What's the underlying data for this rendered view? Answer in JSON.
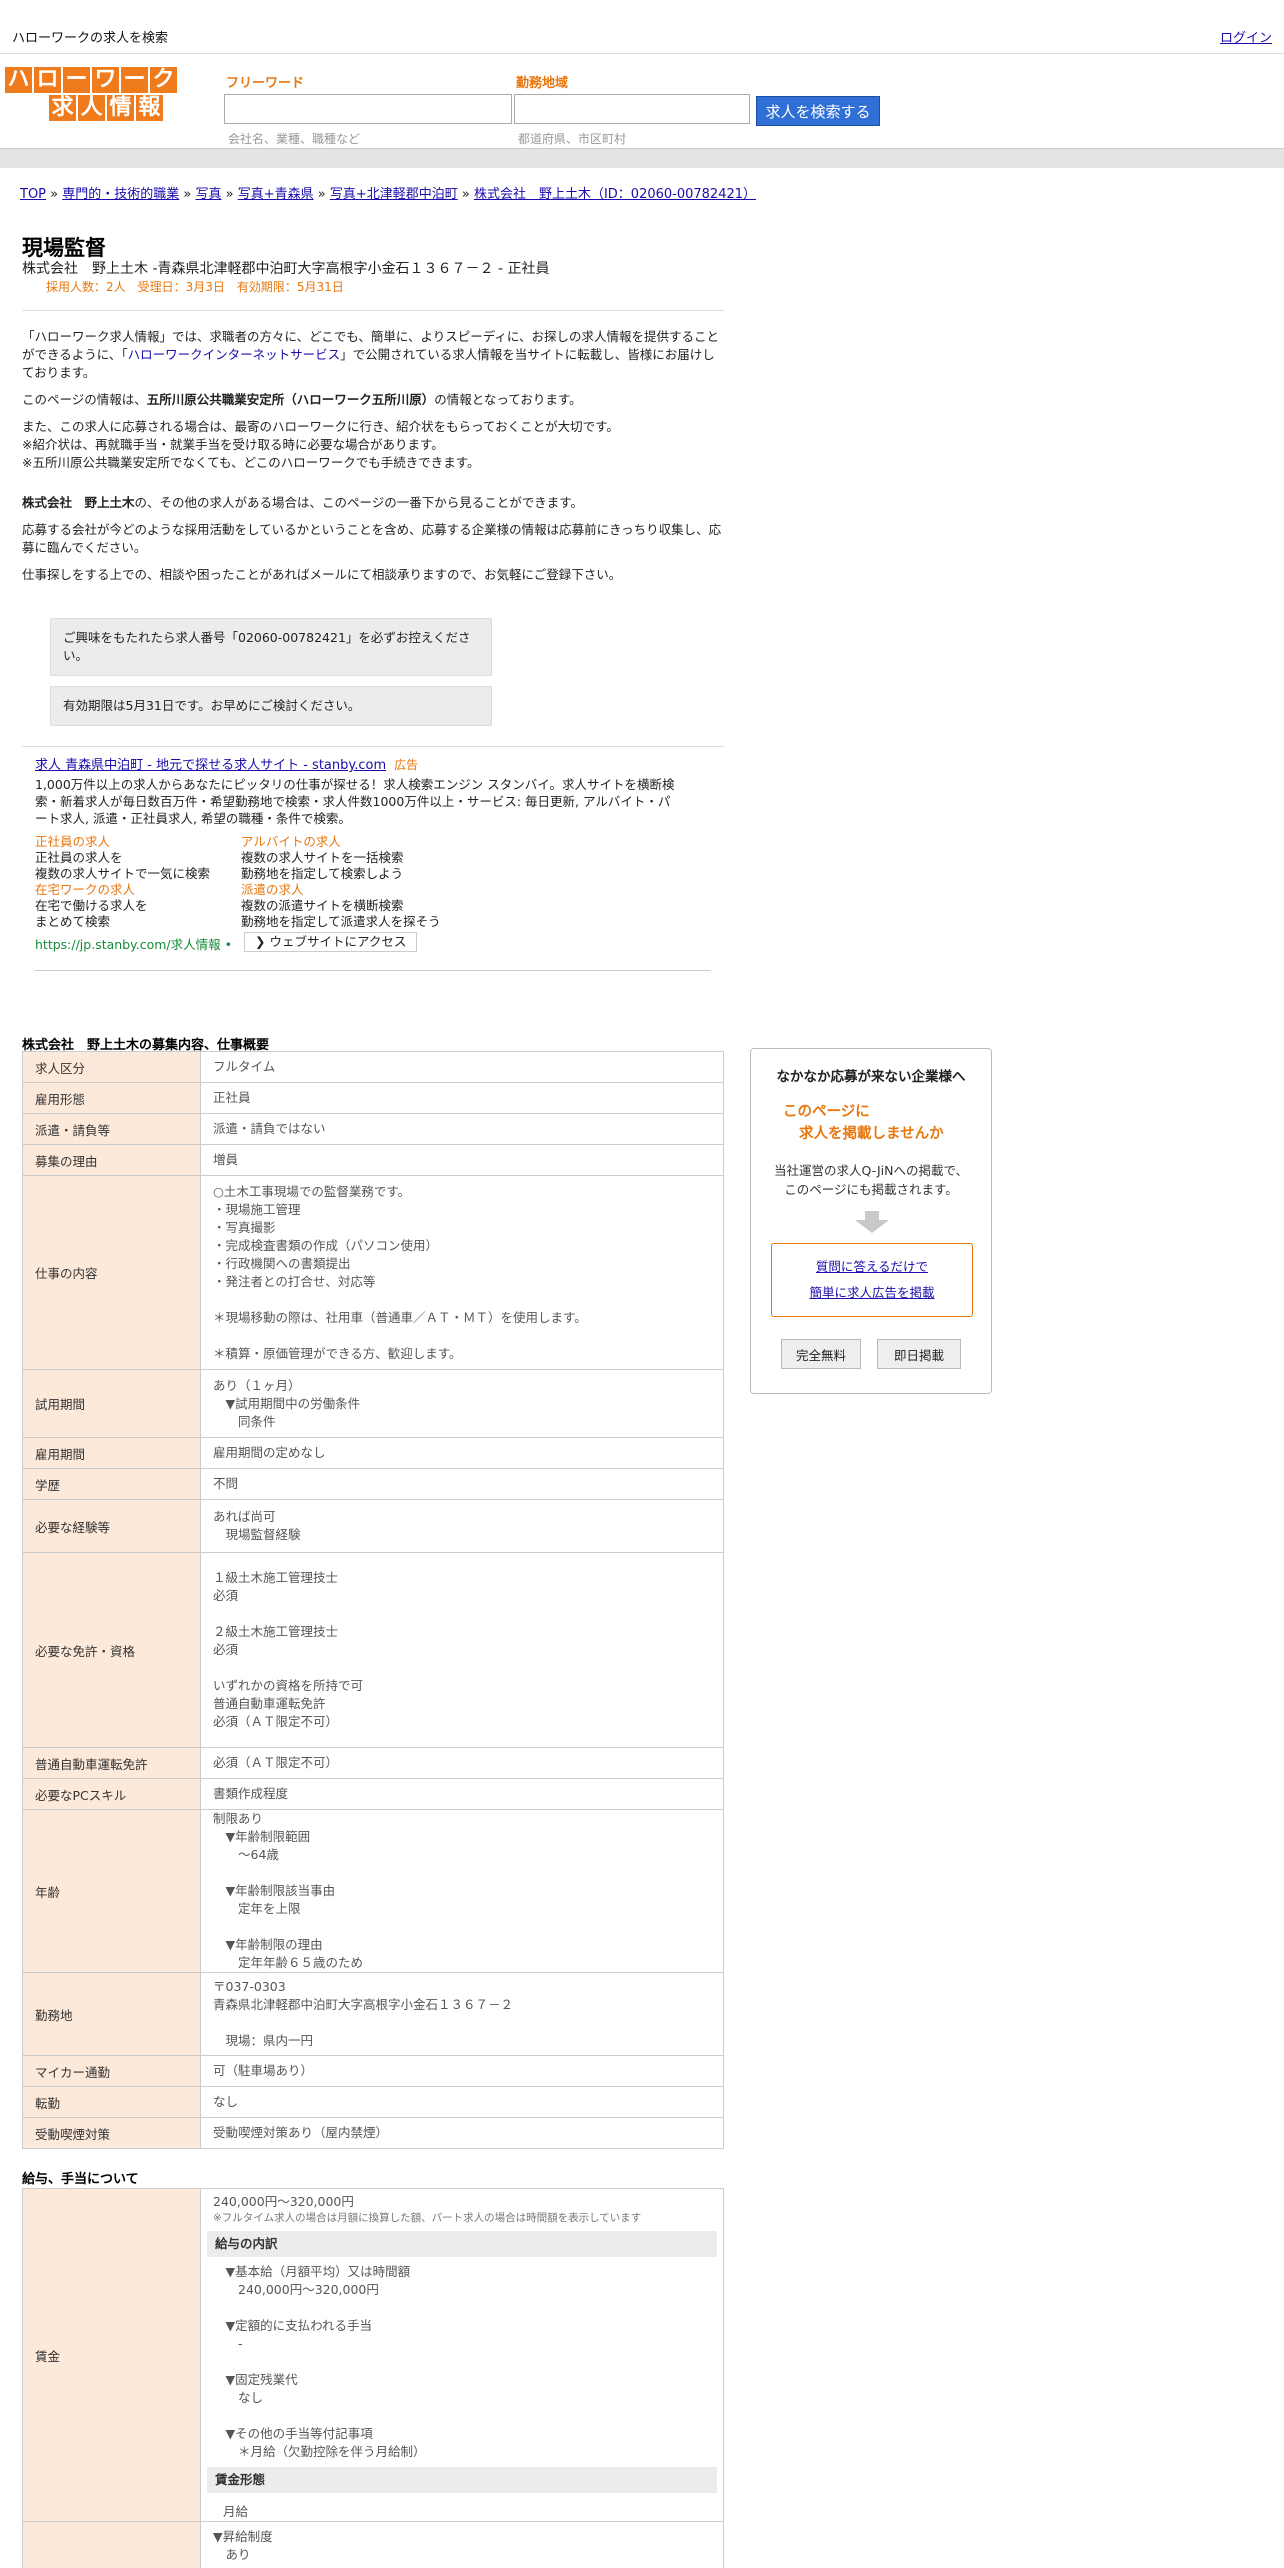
{
  "topbar": {
    "site_title": "ハローワークの求人を検索",
    "login": "ログイン"
  },
  "logo": {
    "row1": [
      "ハ",
      "ロ",
      "ー",
      "ワ",
      "ー",
      "ク"
    ],
    "row2": [
      "求",
      "人",
      "情",
      "報"
    ]
  },
  "search": {
    "freeword_label": "フリーワード",
    "freeword_hint": "会社名、業種、職種など",
    "area_label": "勤務地域",
    "area_hint": "都道府県、市区町村",
    "button": "求人を検索する"
  },
  "breadcrumb": {
    "items": [
      "TOP",
      "専門的・技術的職業",
      "写真",
      "写真+青森県",
      "写真+北津軽郡中泊町",
      "株式会社　野上土木（ID：02060-00782421）"
    ],
    "sep": " » "
  },
  "job": {
    "title": "現場監督",
    "company_line": "株式会社　野上土木 -青森県北津軽郡中泊町大字高根字小金石１３６７－２ - 正社員",
    "meta": "採用人数：2人　受理日：3月3日　有効期限：5月31日"
  },
  "intro": {
    "p1a": "「ハローワーク求人情報」では、求職者の方々に、どこでも、簡単に、よりスピーディに、お探しの求人情報を提供することができるように、「",
    "p1_link": "ハローワークインターネットサービス",
    "p1b": "」で公開されている求人情報を当サイトに転載し、皆様にお届けしております。",
    "p2a": "このページの情報は、",
    "p2_bold": "五所川原公共職業安定所（ハローワーク五所川原）",
    "p2b": "の情報となっております。",
    "p3": "また、この求人に応募される場合は、最寄のハローワークに行き、紹介状をもらっておくことが大切です。",
    "p4": "※紹介状は、再就職手当・就業手当を受け取る時に必要な場合があります。",
    "p5": "※五所川原公共職業安定所でなくても、どこのハローワークでも手続きできます。",
    "p6_bold": "株式会社　野上土木",
    "p6": "の、その他の求人がある場合は、このページの一番下から見ることができます。",
    "p7": "応募する会社が今どのような採用活動をしているかということを含め、応募する企業様の情報は応募前にきっちり収集し、応募に臨んでください。",
    "p8": "仕事探しをする上での、相談や困ったことがあればメールにて相談承りますので、お気軽にご登録下さい。"
  },
  "notes": {
    "n1": "ご興味をもたれたら求人番号「02060-00782421」を必ずお控えください。",
    "n2": "有効期限は5月31日です。お早めにご検討ください。"
  },
  "ad": {
    "link": "求人 青森県中泊町 - 地元で探せる求人サイト - stanby.com",
    "tag": "広告",
    "desc": "1,000万件以上の求人からあなたにピッタリの仕事が探せる！求人検索エンジン スタンバイ。求人サイトを横断検索・新着求人が毎日数百万件・希望勤務地で検索・求人件数1000万件以上・サービス: 毎日更新, アルバイト・パート求人, 派遣・正社員求人, 希望の職種・条件で検索。",
    "sitelinks": [
      {
        "h": "正社員の求人",
        "l1": "正社員の求人を",
        "l2": "複数の求人サイトで一気に検索"
      },
      {
        "h": "アルバイトの求人",
        "l1": "複数の求人サイトを一括検索",
        "l2": "勤務地を指定して検索しよう"
      },
      {
        "h": "在宅ワークの求人",
        "l1": "在宅で働ける求人を",
        "l2": "まとめて検索"
      },
      {
        "h": "派遣の求人",
        "l1": "複数の派遣サイトを横断検索",
        "l2": "勤務地を指定して派遣求人を探そう"
      }
    ],
    "url": "https://jp.stanby.com/求人情報",
    "url_dot": "•",
    "visit_button": "❯ ウェブサイトにアクセス"
  },
  "detail": {
    "section_title": "株式会社　野上土木の募集内容、仕事概要",
    "rows": [
      {
        "k": "求人区分",
        "v": "フルタイム"
      },
      {
        "k": "雇用形態",
        "v": "正社員"
      },
      {
        "k": "派遣・請負等",
        "v": "派遣・請負ではない"
      },
      {
        "k": "募集の理由",
        "v": "増員"
      },
      {
        "k": "仕事の内容",
        "v": "○土木工事現場での監督業務です。\n・現場施工管理\n・写真撮影\n・完成検査書類の作成（パソコン使用）\n・行政機関への書類提出\n・発注者との打合せ、対応等\n\n＊現場移動の際は、社用車（普通車／ＡＴ・ＭＴ）を使用します。\n\n＊積算・原価管理ができる方、歓迎します。"
      },
      {
        "k": "試用期間",
        "v": "あり（１ヶ月）\n　▼試用期間中の労働条件\n　　同条件"
      },
      {
        "k": "雇用期間",
        "v": "雇用期間の定めなし"
      },
      {
        "k": "学歴",
        "v": "不問"
      },
      {
        "k": "必要な経験等",
        "v": "あれば尚可\n　現場監督経験"
      },
      {
        "k": "必要な免許・資格",
        "v": "１級土木施工管理技士\n必須\n\n２級土木施工管理技士\n必須\n\nいずれかの資格を所持で可\n普通自動車運転免許\n必須（ＡＴ限定不可）"
      },
      {
        "k": "普通自動車運転免許",
        "v": "必須（ＡＴ限定不可）"
      },
      {
        "k": "必要なPCスキル",
        "v": "書類作成程度"
      },
      {
        "k": "年齢",
        "v": "制限あり\n　▼年齢制限範囲\n　　～64歳\n\n　▼年齢制限該当事由\n　　定年を上限\n\n　▼年齢制限の理由\n　　定年年齢６５歳のため"
      },
      {
        "k": "勤務地",
        "v": "〒037-0303\n青森県北津軽郡中泊町大字高根字小金石１３６７－２\n\n　現場：県内一円"
      },
      {
        "k": "マイカー通勤",
        "v": "可（駐車場あり）"
      },
      {
        "k": "転勤",
        "v": "なし"
      },
      {
        "k": "受動喫煙対策",
        "v": "受動喫煙対策あり（屋内禁煙）"
      }
    ]
  },
  "wage": {
    "section_title": "給与、手当について",
    "label": "賃金",
    "range": "240,000円〜320,000円",
    "note": "※フルタイム求人の場合は月額に換算した額、パート求人の場合は時間額を表示しています",
    "breakdown_title": "給与の内訳",
    "breakdown": "　▼基本給（月額平均）又は時間額\n　　240,000円〜320,000円\n\n　▼定額的に支払われる手当\n　　-\n\n　▼固定残業代\n　　なし\n\n　▼その他の手当等付記事項\n　　＊月給（欠勤控除を伴う月給制）",
    "form_title": "賃金形態",
    "form": "月給",
    "raise": "▼昇給制度\n　あり"
  },
  "sidebar": {
    "title": "なかなか応募が来ない企業様へ",
    "highlight1": "このページに",
    "highlight2": "求人を掲載しませんか",
    "text1": "当社運営の求人Q-JiNへの掲載で、",
    "text2": "このページにも掲載されます。",
    "link1": "質問に答えるだけで",
    "link2": "簡単に求人広告を掲載",
    "btn1": "完全無料",
    "btn2": "即日掲載"
  }
}
